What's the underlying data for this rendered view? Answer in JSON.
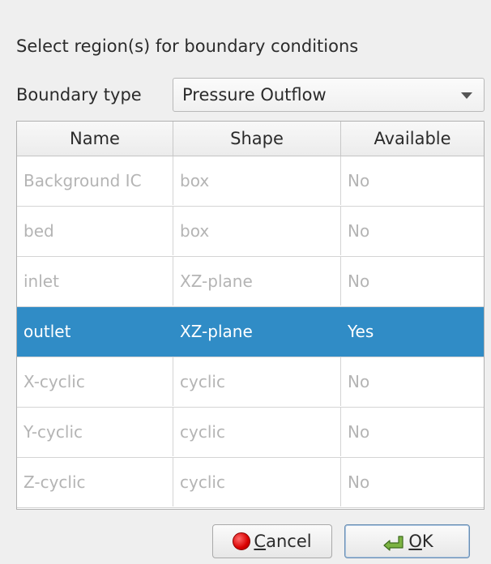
{
  "dialog": {
    "title": "Select region(s) for boundary conditions"
  },
  "boundary_type": {
    "label": "Boundary type",
    "value": "Pressure Outflow"
  },
  "table": {
    "columns": [
      "Name",
      "Shape",
      "Available"
    ],
    "rows": [
      {
        "name": "Background IC",
        "shape": "box",
        "available": "No"
      },
      {
        "name": "bed",
        "shape": "box",
        "available": "No"
      },
      {
        "name": "inlet",
        "shape": "XZ-plane",
        "available": "No"
      },
      {
        "name": "outlet",
        "shape": "XZ-plane",
        "available": "Yes"
      },
      {
        "name": "X-cyclic",
        "shape": "cyclic",
        "available": "No"
      },
      {
        "name": "Y-cyclic",
        "shape": "cyclic",
        "available": "No"
      },
      {
        "name": "Z-cyclic",
        "shape": "cyclic",
        "available": "No"
      }
    ],
    "selected_row": "outlet"
  },
  "buttons": {
    "cancel_accel": "C",
    "cancel_rest": "ancel",
    "ok_accel": "O",
    "ok_rest": "K"
  },
  "colors": {
    "selection": "#308cc6",
    "disabled_text": "#b4b4b4",
    "background": "#efefef"
  },
  "icons": {
    "cancel": "red-stop-circle-icon",
    "ok": "green-check-arrow-icon"
  }
}
